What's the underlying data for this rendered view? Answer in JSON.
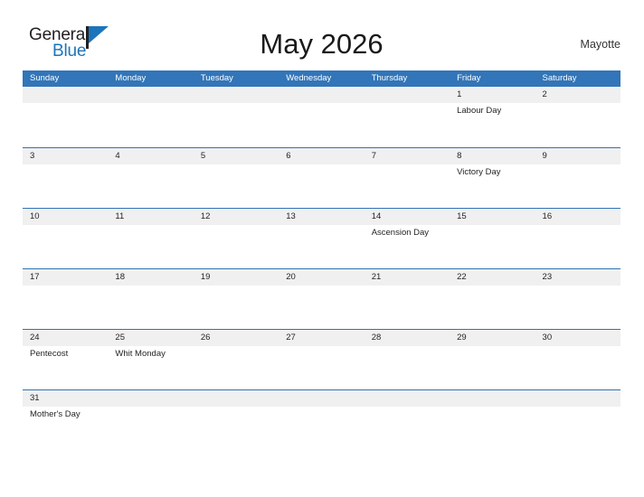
{
  "branding": {
    "logo_word_1": "General",
    "logo_word_2": "Blue",
    "logo_flag_icon": "flag-triangle-icon"
  },
  "header": {
    "title": "May 2026",
    "region": "Mayotte"
  },
  "calendar": {
    "weekday_headers": [
      "Sunday",
      "Monday",
      "Tuesday",
      "Wednesday",
      "Thursday",
      "Friday",
      "Saturday"
    ],
    "accent_color": "#3275b8",
    "row_border_color": "#2f74b5",
    "date_strip_color": "#f0f0f0",
    "weeks": [
      {
        "days": [
          {
            "date": "",
            "event": ""
          },
          {
            "date": "",
            "event": ""
          },
          {
            "date": "",
            "event": ""
          },
          {
            "date": "",
            "event": ""
          },
          {
            "date": "",
            "event": ""
          },
          {
            "date": "1",
            "event": "Labour Day"
          },
          {
            "date": "2",
            "event": ""
          }
        ]
      },
      {
        "days": [
          {
            "date": "3",
            "event": ""
          },
          {
            "date": "4",
            "event": ""
          },
          {
            "date": "5",
            "event": ""
          },
          {
            "date": "6",
            "event": ""
          },
          {
            "date": "7",
            "event": ""
          },
          {
            "date": "8",
            "event": "Victory Day"
          },
          {
            "date": "9",
            "event": ""
          }
        ]
      },
      {
        "days": [
          {
            "date": "10",
            "event": ""
          },
          {
            "date": "11",
            "event": ""
          },
          {
            "date": "12",
            "event": ""
          },
          {
            "date": "13",
            "event": ""
          },
          {
            "date": "14",
            "event": "Ascension Day"
          },
          {
            "date": "15",
            "event": ""
          },
          {
            "date": "16",
            "event": ""
          }
        ]
      },
      {
        "days": [
          {
            "date": "17",
            "event": ""
          },
          {
            "date": "18",
            "event": ""
          },
          {
            "date": "19",
            "event": ""
          },
          {
            "date": "20",
            "event": ""
          },
          {
            "date": "21",
            "event": ""
          },
          {
            "date": "22",
            "event": ""
          },
          {
            "date": "23",
            "event": ""
          }
        ]
      },
      {
        "days": [
          {
            "date": "24",
            "event": "Pentecost"
          },
          {
            "date": "25",
            "event": "Whit Monday"
          },
          {
            "date": "26",
            "event": ""
          },
          {
            "date": "27",
            "event": ""
          },
          {
            "date": "28",
            "event": ""
          },
          {
            "date": "29",
            "event": ""
          },
          {
            "date": "30",
            "event": ""
          }
        ]
      },
      {
        "days": [
          {
            "date": "31",
            "event": "Mother's Day"
          },
          {
            "date": "",
            "event": ""
          },
          {
            "date": "",
            "event": ""
          },
          {
            "date": "",
            "event": ""
          },
          {
            "date": "",
            "event": ""
          },
          {
            "date": "",
            "event": ""
          },
          {
            "date": "",
            "event": ""
          }
        ]
      }
    ]
  }
}
